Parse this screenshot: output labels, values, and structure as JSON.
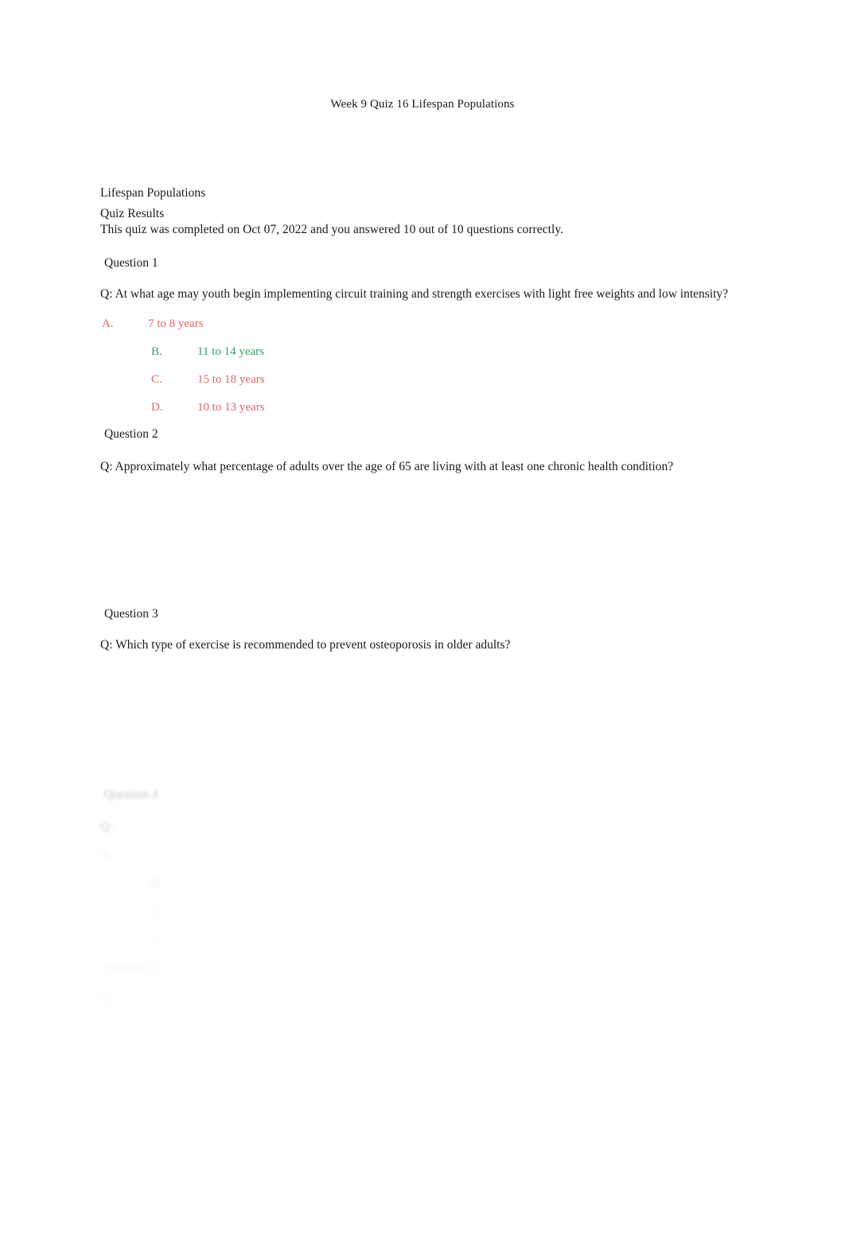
{
  "document": {
    "header_title": "Week 9 Quiz 16 Lifespan Populations",
    "course_title": "Lifespan Populations",
    "results_label": "Quiz Results",
    "results_summary": "This quiz was completed on Oct 07, 2022 and you answered 10 out of 10 questions correctly."
  },
  "colors": {
    "text": "#1a1a1a",
    "incorrect": "#e06666",
    "correct": "#38a169"
  },
  "questions": [
    {
      "heading": "Question 1",
      "prompt": "Q: At what age may youth begin implementing circuit training and strength exercises with light free weights and low intensity?",
      "options": [
        {
          "letter": "A.",
          "text": "7 to 8 years",
          "state": "wrong",
          "indent": 1
        },
        {
          "letter": "B.",
          "text": "11 to 14 years",
          "state": "correct",
          "indent": 2
        },
        {
          "letter": "C.",
          "text": "15 to 18 years",
          "state": "wrong",
          "indent": 2
        },
        {
          "letter": "D.",
          "text": "10 to 13 years",
          "state": "wrong",
          "indent": 2
        }
      ]
    },
    {
      "heading": "Question 2",
      "prompt": "Q: Approximately what percentage of adults over the age of 65 are living with at least one chronic health condition?",
      "options": []
    },
    {
      "heading": "Question 3",
      "prompt": "Q: Which type of exercise is recommended to prevent osteoporosis in older adults?",
      "options": []
    }
  ],
  "obscured": {
    "note": "Lower portion of the page is blurred and faded out; text is not legible.",
    "question_4": {
      "heading": "Question 4",
      "prompt": "Q: ",
      "options": [
        {
          "letter": "A.",
          "text": "",
          "state": "wrong",
          "indent": 1
        },
        {
          "letter": "B.",
          "text": "",
          "state": "wrong",
          "indent": 2
        },
        {
          "letter": "C.",
          "text": "",
          "state": "wrong",
          "indent": 2
        },
        {
          "letter": "D.",
          "text": "",
          "state": "correct",
          "indent": 2
        }
      ]
    },
    "question_5": {
      "heading": "Question 5",
      "prompt": "Q: ",
      "options": []
    }
  }
}
